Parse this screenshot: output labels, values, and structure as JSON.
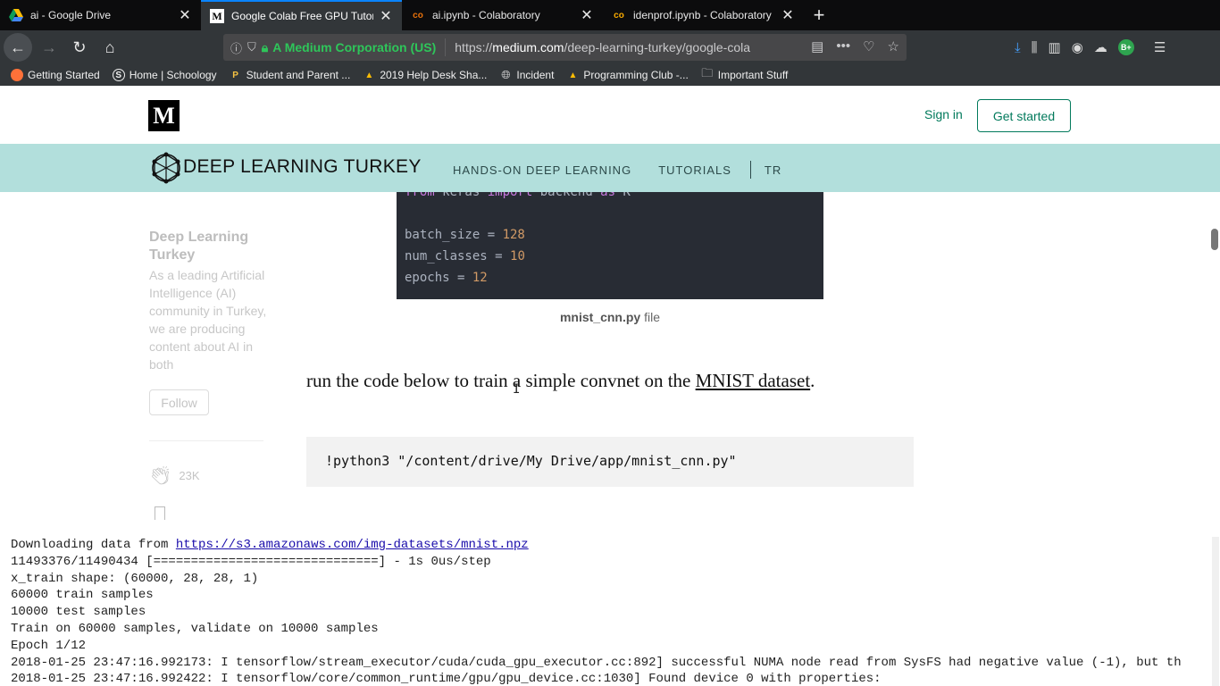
{
  "browser": {
    "tabs": [
      {
        "title": "ai - Google Drive",
        "icon": "google-drive-icon",
        "active": false
      },
      {
        "title": "Google Colab Free GPU Tutorial",
        "icon": "medium-icon",
        "active": true
      },
      {
        "title": "ai.ipynb - Colaboratory",
        "icon": "colab-icon",
        "active": false
      },
      {
        "title": "idenprof.ipynb - Colaboratory",
        "icon": "colab-icon",
        "active": false
      }
    ],
    "identity": "A Medium Corporation (US)",
    "url_prefix": "https://",
    "url_domain": "medium.com",
    "url_path": "/deep-learning-turkey/google-cola",
    "bookmarks": [
      {
        "label": "Getting Started",
        "icon": "firefox-icon"
      },
      {
        "label": "Home | Schoology",
        "icon": "schoology-icon"
      },
      {
        "label": "Student and Parent ...",
        "icon": "p-icon"
      },
      {
        "label": "2019 Help Desk Sha...",
        "icon": "drive-icon"
      },
      {
        "label": "Incident",
        "icon": "globe-icon"
      },
      {
        "label": "Programming Club -...",
        "icon": "drive-icon"
      },
      {
        "label": "Important Stuff",
        "icon": "folder-icon"
      }
    ],
    "profile_badge": "B+"
  },
  "medium": {
    "logo": "M",
    "signin": "Sign in",
    "get_started": "Get started"
  },
  "publication": {
    "name_bold": "DEEP LEARNING",
    "name_rest": " TURKEY",
    "nav": [
      "HANDS-ON DEEP LEARNING",
      "TUTORIALS",
      "TR"
    ]
  },
  "sidebar": {
    "title": "Deep Learning Turkey",
    "description": "As a leading Artificial Intelligence (AI) community in Turkey, we are producing content about AI in both",
    "follow": "Follow",
    "claps": "23K"
  },
  "article": {
    "code_top": {
      "line1_kw1": "from",
      "line1_mod": " keras ",
      "line1_kw2": "import",
      "line1_name": " backend ",
      "line1_kw3": "as",
      "line1_alias": " K",
      "batch_size_var": "batch_size = ",
      "batch_size_val": "128",
      "num_classes_var": "num_classes = ",
      "num_classes_val": "10",
      "epochs_var": "epochs = ",
      "epochs_val": "12"
    },
    "caption_bold": "mnist_cnn.py",
    "caption_rest": " file",
    "para_before": "run the code below to train a simple convnet on the ",
    "para_link": "MNIST dataset",
    "para_after": ".",
    "command": "!python3 \"/content/drive/My Drive/app/mnist_cnn.py\""
  },
  "terminal": {
    "download_prefix": "Downloading data from ",
    "download_link": "https://s3.amazonaws.com/img-datasets/mnist.npz",
    "lines": [
      "11493376/11490434 [==============================] - 1s 0us/step",
      "x_train shape: (60000, 28, 28, 1)",
      "60000 train samples",
      "10000 test samples",
      "Train on 60000 samples, validate on 10000 samples",
      "Epoch 1/12",
      "2018-01-25 23:47:16.992173: I tensorflow/stream_executor/cuda/cuda_gpu_executor.cc:892] successful NUMA node read from SysFS had negative value (-1), but th",
      "2018-01-25 23:47:16.992422: I tensorflow/core/common_runtime/gpu/gpu_device.cc:1030] Found device 0 with properties:"
    ]
  }
}
